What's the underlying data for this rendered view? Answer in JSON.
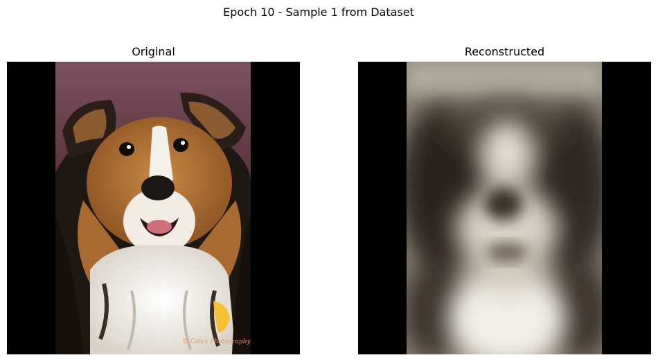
{
  "figure": {
    "title": "Epoch 10 - Sample 1 from Dataset"
  },
  "panels": [
    {
      "title": "Original"
    },
    {
      "title": "Reconstructed"
    }
  ],
  "watermark": {
    "text": "© Calex Photography"
  },
  "colors": {
    "background": "#ffffff",
    "pad": "#000000",
    "backdrop": "#6e4652",
    "fur_tan": "#b07030",
    "fur_dark": "#1a1410",
    "fur_white": "#f2efe9",
    "nose": "#1c1818",
    "tongue": "#d0707a",
    "tag": "#f5c030",
    "recon_light": "#e6e2d8",
    "recon_dark": "#2a241e"
  }
}
